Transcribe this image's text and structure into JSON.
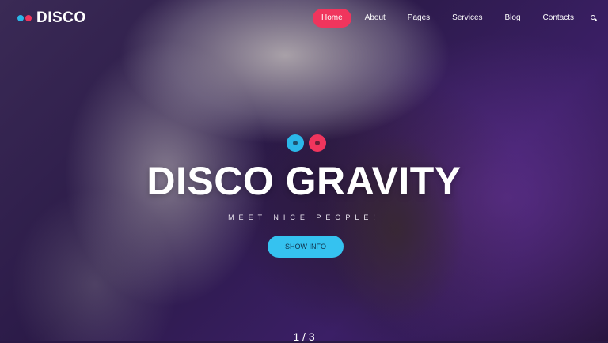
{
  "brand": {
    "name": "DISCO"
  },
  "nav": {
    "items": [
      {
        "label": "Home"
      },
      {
        "label": "About"
      },
      {
        "label": "Pages"
      },
      {
        "label": "Services"
      },
      {
        "label": "Blog"
      },
      {
        "label": "Contacts"
      }
    ],
    "active_item": "Home",
    "search_icon": "search-icon"
  },
  "hero": {
    "title": "DISCO GRAVITY",
    "subtitle": "MEET NICE PEOPLE!",
    "button_label": "SHOW INFO",
    "pager": "1 / 3"
  },
  "colors": {
    "accent_pink": "#f0355d",
    "accent_blue": "#35c2f0"
  }
}
